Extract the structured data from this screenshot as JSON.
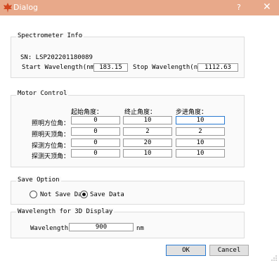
{
  "window": {
    "title": "Dialog",
    "help_glyph": "?",
    "close_glyph": "✕",
    "accent": "#e8a98a"
  },
  "spectrometer": {
    "title": "Spectrometer Info",
    "sn": "SN: LSP202201180089",
    "start_label": "Start Wavelength(nm)",
    "start_value": "183.15",
    "stop_label": "Stop Wavelength(nm)",
    "stop_value": "1112.63"
  },
  "motor": {
    "title": "Motor Control",
    "headers": [
      "起始角度：",
      "终止角度：",
      "步进角度："
    ],
    "rows": [
      {
        "label": "照明方位角：",
        "start": "0",
        "stop": "10",
        "step": "10"
      },
      {
        "label": "照明天顶角：",
        "start": "0",
        "stop": "2",
        "step": "2"
      },
      {
        "label": "探测方位角：",
        "start": "0",
        "stop": "20",
        "step": "10"
      },
      {
        "label": "探测天顶角：",
        "start": "0",
        "stop": "10",
        "step": "10"
      }
    ]
  },
  "save": {
    "title": "Save Option",
    "not_save_label": "Not Save Dat",
    "save_label": "Save Data",
    "selected": "Save Data"
  },
  "display3d": {
    "title": "Wavelength for 3D Display",
    "label": "Wavelength:",
    "value": "900",
    "unit": "nm"
  },
  "buttons": {
    "ok": "OK",
    "cancel": "Cancel"
  }
}
